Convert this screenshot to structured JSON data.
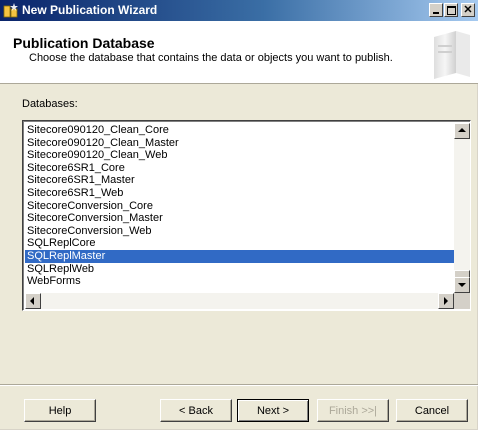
{
  "window": {
    "title": "New Publication Wizard"
  },
  "header": {
    "title": "Publication Database",
    "subtitle": "Choose the database that contains the data or objects you want to publish."
  },
  "databases": {
    "label": "Databases:",
    "items": [
      "Sitecore090120_Clean_Core",
      "Sitecore090120_Clean_Master",
      "Sitecore090120_Clean_Web",
      "Sitecore6SR1_Core",
      "Sitecore6SR1_Master",
      "Sitecore6SR1_Web",
      "SitecoreConversion_Core",
      "SitecoreConversion_Master",
      "SitecoreConversion_Web",
      "SQLReplCore",
      "SQLReplMaster",
      "SQLReplWeb",
      "WebForms"
    ],
    "selected_index": 10
  },
  "buttons": {
    "help": "Help",
    "back": "< Back",
    "next": "Next >",
    "finish": "Finish >>|",
    "cancel": "Cancel"
  },
  "colors": {
    "selection": "#316ac5",
    "titlebar": "#0a246a"
  }
}
